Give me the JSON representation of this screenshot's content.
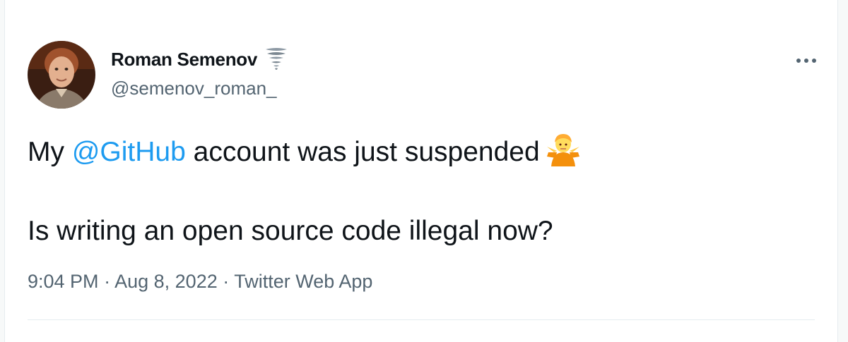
{
  "author": {
    "display_name": "Roman Semenov",
    "handle": "@semenov_roman_",
    "badge_icon": "tornado-icon",
    "avatar_icon": "profile-photo"
  },
  "tweet": {
    "line1_prefix": "My",
    "mention": "@GitHub",
    "line1_suffix": "account was just suspended",
    "line1_emoji": "person-shrugging-icon",
    "line2": "Is writing an open source code illegal now?"
  },
  "meta": {
    "time": "9:04 PM",
    "separator": "·",
    "date": "Aug 8, 2022",
    "source": "Twitter Web App"
  },
  "menu": {
    "more_icon": "more-icon"
  },
  "colors": {
    "link": "#1d9bf0",
    "secondary_text": "#536471",
    "primary_text": "#0f1419"
  }
}
